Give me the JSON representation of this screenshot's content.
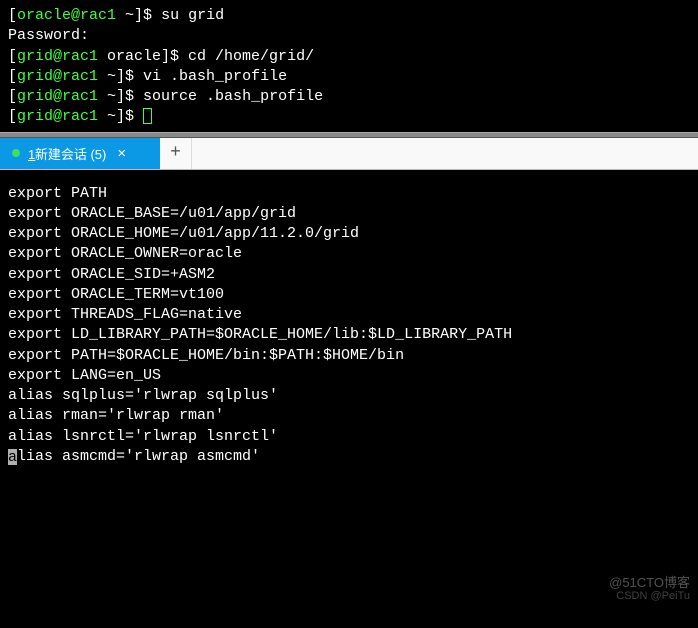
{
  "top_terminal": {
    "l1_prompt_open": "[",
    "l1_userhost": "oracle@rac1",
    "l1_prompt_rest": " ~]$ ",
    "l1_cmd": "su grid",
    "l2": "Password:",
    "l3_prompt_open": "[",
    "l3_userhost": "grid@rac1",
    "l3_prompt_rest": " oracle]$ ",
    "l3_cmd": "cd /home/grid/",
    "l4_prompt_open": "[",
    "l4_userhost": "grid@rac1",
    "l4_prompt_rest": " ~]$ ",
    "l4_cmd": "vi .bash_profile",
    "l5_prompt_open": "[",
    "l5_userhost": "grid@rac1",
    "l5_prompt_rest": " ~]$ ",
    "l5_cmd": "source .bash_profile",
    "l6_prompt_open": "[",
    "l6_userhost": "grid@rac1",
    "l6_prompt_rest": " ~]$ "
  },
  "tabbar": {
    "tab_num": "1",
    "tab_label": " 新建会话 (5)",
    "close_glyph": "×",
    "add_glyph": "+"
  },
  "editor": {
    "lines": {
      "e0": "",
      "e1": "export PATH",
      "e2": "",
      "e3": "export ORACLE_BASE=/u01/app/grid",
      "e4": "export ORACLE_HOME=/u01/app/11.2.0/grid",
      "e5": "export ORACLE_OWNER=oracle",
      "e6": "export ORACLE_SID=+ASM2",
      "e7": "export ORACLE_TERM=vt100",
      "e8": "export THREADS_FLAG=native",
      "e9": "export LD_LIBRARY_PATH=$ORACLE_HOME/lib:$LD_LIBRARY_PATH",
      "e10": "export PATH=$ORACLE_HOME/bin:$PATH:$HOME/bin",
      "e11": "export LANG=en_US",
      "e12": "alias sqlplus='rlwrap sqlplus'",
      "e13": "alias rman='rlwrap rman'",
      "e14": "alias lsnrctl='rlwrap lsnrctl'",
      "e15_rest": "lias asmcmd='rlwrap asmcmd'",
      "e15_cursor_char": "a"
    }
  },
  "watermark": {
    "w1": "@51CTO博客",
    "w2": "CSDN @PeiTu"
  }
}
